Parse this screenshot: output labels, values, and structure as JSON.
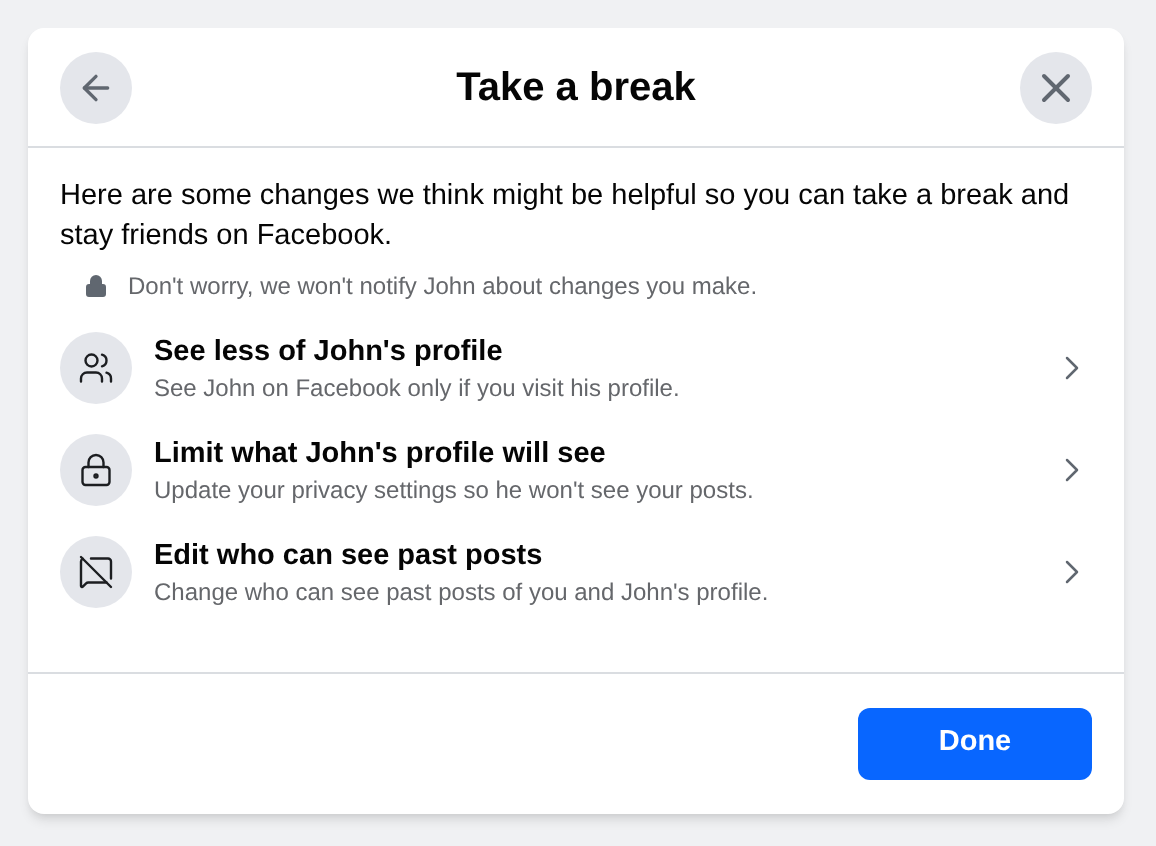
{
  "dialog": {
    "title": "Take a break",
    "intro": "Here are some changes we think might be helpful so you can take a break and stay friends on Facebook.",
    "notice": "Don't worry, we won't notify John about changes you make.",
    "options": [
      {
        "kind": "people",
        "title": "See less of John's profile",
        "description": "See John on Facebook only if you visit his profile."
      },
      {
        "kind": "lock",
        "title": "Limit what John's profile will see",
        "description": "Update your privacy settings so he won't see your posts."
      },
      {
        "kind": "posts",
        "title": "Edit who can see past posts",
        "description": "Change who can see past posts of you and John's profile."
      }
    ],
    "done_button": "Done"
  }
}
